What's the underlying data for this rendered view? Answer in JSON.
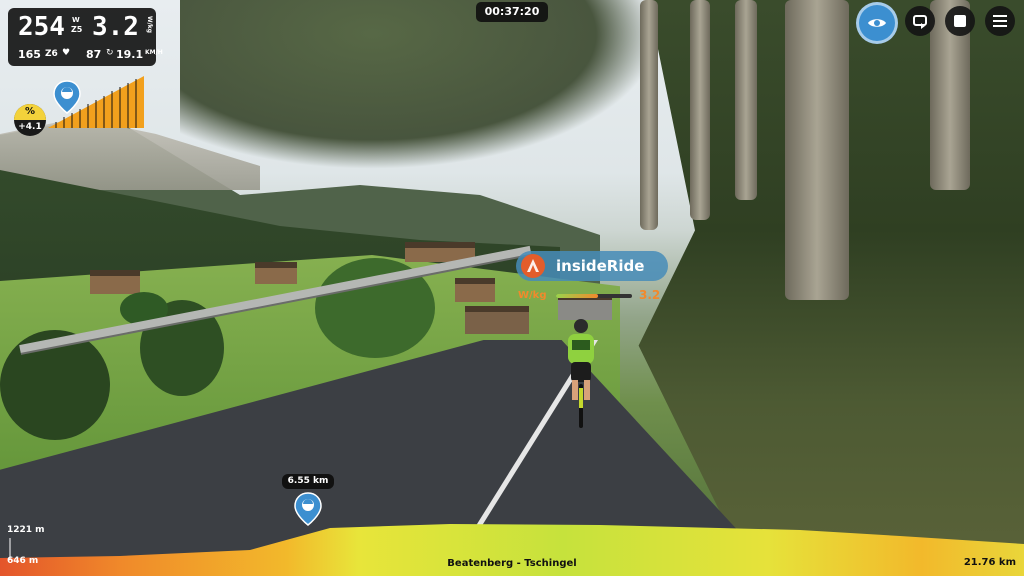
{
  "stats": {
    "power": "254",
    "power_unit_top": "W",
    "power_zone": "Z5",
    "wkg": "3.2",
    "wkg_unit": "W/kg",
    "cadence": "165",
    "hr_zone": "Z6",
    "speed_rpm": "87",
    "speed": "19.1",
    "speed_unit": "KM/H"
  },
  "grade": {
    "icon": "percent",
    "value": "+4.1"
  },
  "timer": "00:37:20",
  "controls": [
    {
      "name": "view-eye-button",
      "icon": "eye-icon"
    },
    {
      "name": "repeat-button",
      "icon": "repeat-icon"
    },
    {
      "name": "stop-button",
      "icon": "stop-icon"
    },
    {
      "name": "menu-button",
      "icon": "hamburger-icon"
    }
  ],
  "rider_tag": {
    "name": "insideRide",
    "metric_label": "W/kg",
    "metric_value": "3.2",
    "metric_fraction": 0.55
  },
  "profile": {
    "position_label": "6.55 km",
    "elevation_max": "1221 m",
    "elevation_min": "646 m",
    "route_name": "Beatenberg - Tschingel",
    "total_distance": "21.76 km"
  },
  "colors": {
    "accent_blue": "#3c8fd0",
    "grade_yellow": "#f3d23b",
    "wkg_orange": "#f2892c"
  }
}
